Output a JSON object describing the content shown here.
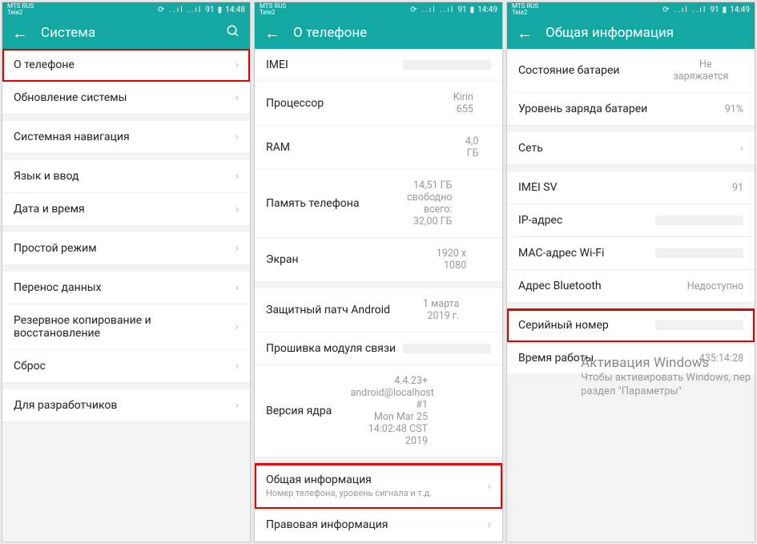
{
  "statusbar": {
    "carrier_line1": "MTS RUS",
    "carrier_line2": "Tele2",
    "battery1": "91",
    "time1": "14:48",
    "time2": "14:49",
    "sync_icon": "⟳",
    "signal_icons": "📶 📶",
    "battery_icon": "▮"
  },
  "screen1": {
    "title": "Система",
    "items": [
      {
        "label": "О телефоне",
        "chev": true,
        "highlight": true
      },
      {
        "label": "Обновление системы",
        "chev": true
      },
      {
        "label": "Системная навигация",
        "chev": true,
        "gap": true
      },
      {
        "label": "Язык и ввод",
        "chev": true,
        "gap": true
      },
      {
        "label": "Дата и время",
        "chev": true
      },
      {
        "label": "Простой режим",
        "chev": true,
        "gap": true
      },
      {
        "label": "Перенос данных",
        "chev": true,
        "gap": true
      },
      {
        "label": "Резервное копирование и восстановление",
        "chev": true
      },
      {
        "label": "Сброс",
        "chev": true
      },
      {
        "label": "Для разработчиков",
        "chev": true,
        "gap": true
      }
    ]
  },
  "screen2": {
    "title": "О телефоне",
    "items": [
      {
        "label": "IMEI",
        "value": "",
        "blur": true
      },
      {
        "label": "Процессор",
        "value": "Kirin 655"
      },
      {
        "label": "RAM",
        "value": "4,0  ГБ"
      },
      {
        "label": "Память телефона",
        "value": "14,51  ГБ свободно",
        "value2": "всего: 32,00  ГБ"
      },
      {
        "label": "Экран",
        "value": "1920 x 1080"
      },
      {
        "label": "Защитный патч Android",
        "value": "1 марта 2019 г.",
        "gap": true
      },
      {
        "label": "Прошивка модуля связи",
        "value": "",
        "blur": true
      },
      {
        "label": "Версия ядра",
        "value": "4.4.23+",
        "value2": "android@localhost #1",
        "value3": "Mon Mar 25 14:02:48 CST 2019"
      },
      {
        "label": "Общая информация",
        "sub": "Номер телефона, уровень сигнала и т.д.",
        "chev": true,
        "highlight": true,
        "gap": true
      },
      {
        "label": "Правовая информация",
        "chev": true
      }
    ]
  },
  "screen3": {
    "title": "Общая информация",
    "items": [
      {
        "label": "Состояние батареи",
        "value": "Не заряжается"
      },
      {
        "label": "Уровень заряда батареи",
        "value": "91%"
      },
      {
        "label": "Сеть",
        "chev": true,
        "gap": true
      },
      {
        "label": "IMEI SV",
        "value": "91",
        "gap": true
      },
      {
        "label": "IP-адрес",
        "value": "",
        "blur": true
      },
      {
        "label": "MAC-адрес Wi-Fi",
        "value": "",
        "blur": true
      },
      {
        "label": "Адрес Bluetooth",
        "value": "Недоступно"
      },
      {
        "label": "Серийный номер",
        "value": "",
        "blur": true,
        "highlight": true,
        "gap": true
      },
      {
        "label": "Время работы",
        "value": "435:14:28"
      }
    ]
  },
  "watermark": {
    "title": "Активация Windows",
    "line2": "Чтобы активировать Windows, пер",
    "line3": "раздел \"Параметры\""
  }
}
